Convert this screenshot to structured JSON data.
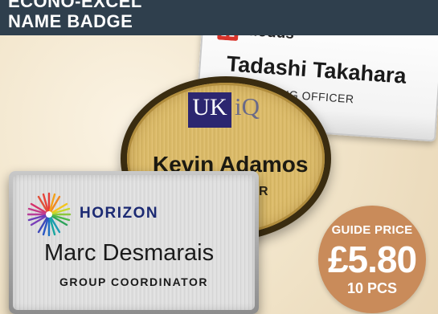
{
  "header": {
    "line1": "ECONO-EXCEL",
    "line2": "NAME BADGE"
  },
  "badges": [
    {
      "logo_icon": "modus-logo-icon",
      "logo_text": "Modus",
      "name": "Tadashi Takahara",
      "title": "OPERATING OFFICER",
      "colors": {
        "finish": "#ffffff",
        "logo": "#d9342b"
      }
    },
    {
      "logo_box_text": "UK",
      "logo_text": "iQ",
      "name": "Kevin Adamos",
      "title_fragment": "R",
      "colors": {
        "finish": "#d9b865",
        "logo": "#2c2670"
      }
    },
    {
      "logo_icon": "horizon-starburst-icon",
      "logo_text": "HORIZON",
      "name": "Marc Desmarais",
      "title": "GROUP COORDINATOR",
      "colors": {
        "finish": "#dcdcdc",
        "logo": "#1c2a73"
      }
    }
  ],
  "price": {
    "label": "GUIDE PRICE",
    "value": "£5.80",
    "quantity": "10 PCS",
    "color": "#c98b5a"
  }
}
